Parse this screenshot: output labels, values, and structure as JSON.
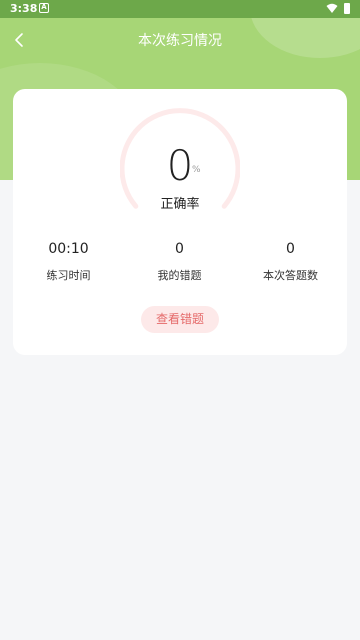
{
  "status_bar": {
    "time": "3:38",
    "notification_icon": "A"
  },
  "header": {
    "title": "本次练习情况"
  },
  "result": {
    "accuracy_value": "0",
    "accuracy_unit": "%",
    "accuracy_label": "正确率",
    "accuracy_fraction": 0
  },
  "stats": [
    {
      "value": "00:10",
      "label": "练习时间"
    },
    {
      "value": "0",
      "label": "我的错题"
    },
    {
      "value": "0",
      "label": "本次答题数"
    }
  ],
  "actions": {
    "review_label": "查看错题"
  },
  "colors": {
    "header": "#a7d676",
    "status_bar": "#6da84a",
    "accent": "#e56a6a"
  }
}
